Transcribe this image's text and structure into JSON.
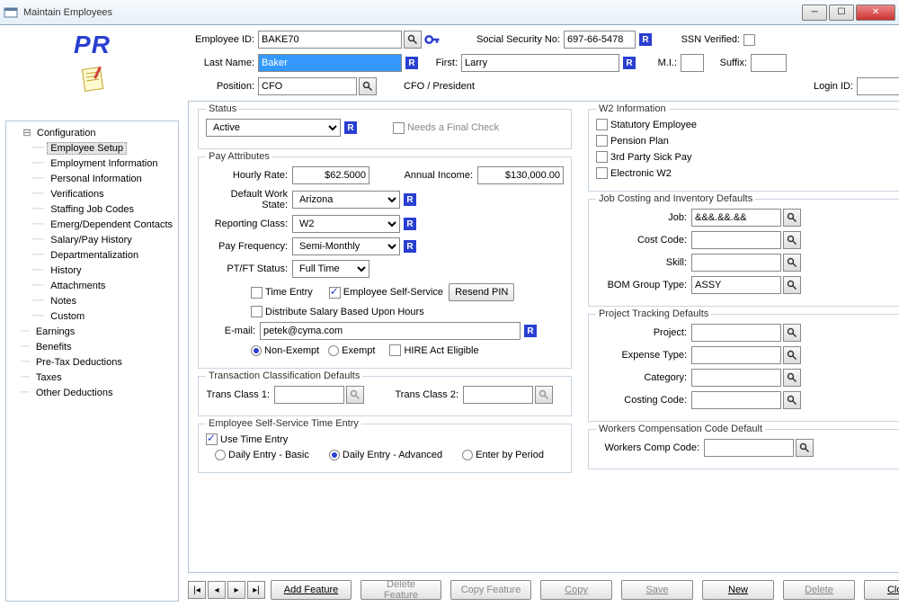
{
  "window": {
    "title": "Maintain Employees"
  },
  "logo": {
    "text": "PR"
  },
  "header": {
    "employee_id_lbl": "Employee ID:",
    "employee_id": "BAKE70",
    "ssn_lbl": "Social Security No:",
    "ssn": "697-66-5478",
    "ssn_verified_lbl": "SSN Verified:",
    "last_name_lbl": "Last Name:",
    "last_name": "Baker",
    "first_lbl": "First:",
    "first": "Larry",
    "mi_lbl": "M.I.:",
    "mi": "",
    "suffix_lbl": "Suffix:",
    "suffix": "",
    "position_lbl": "Position:",
    "position": "CFO",
    "position_desc": "CFO / President",
    "login_id_lbl": "Login ID:",
    "login_id": ""
  },
  "tree": {
    "configuration": "Configuration",
    "items": [
      "Employee Setup",
      "Employment Information",
      "Personal Information",
      "Verifications",
      "Staffing Job Codes",
      "Emerg/Dependent Contacts",
      "Salary/Pay History",
      "Departmentalization",
      "History",
      "Attachments",
      "Notes",
      "Custom"
    ],
    "roots": [
      "Earnings",
      "Benefits",
      "Pre-Tax Deductions",
      "Taxes",
      "Other Deductions"
    ]
  },
  "status": {
    "legend": "Status",
    "value": "Active",
    "needs_final": "Needs a Final Check"
  },
  "pay": {
    "legend": "Pay Attributes",
    "hourly_lbl": "Hourly Rate:",
    "hourly": "$62.5000",
    "annual_lbl": "Annual Income:",
    "annual": "$130,000.00",
    "workstate_lbl": "Default Work State:",
    "workstate": "Arizona",
    "repclass_lbl": "Reporting Class:",
    "repclass": "W2",
    "payfreq_lbl": "Pay Frequency:",
    "payfreq": "Semi-Monthly",
    "ptft_lbl": "PT/FT Status:",
    "ptft": "Full Time",
    "time_entry": "Time Entry",
    "ess": "Employee Self-Service",
    "resend_pin": "Resend PIN",
    "dist_salary": "Distribute Salary Based Upon Hours",
    "email_lbl": "E-mail:",
    "email": "petek@cyma.com",
    "nonexempt": "Non-Exempt",
    "exempt": "Exempt",
    "hire_act": "HIRE Act Eligible"
  },
  "tcd": {
    "legend": "Transaction Classification Defaults",
    "c1_lbl": "Trans Class 1:",
    "c1": "",
    "c2_lbl": "Trans Class 2:",
    "c2": ""
  },
  "ess_time": {
    "legend": "Employee Self-Service Time Entry",
    "use": "Use Time Entry",
    "basic": "Daily Entry - Basic",
    "adv": "Daily Entry - Advanced",
    "period": "Enter by Period"
  },
  "w2info": {
    "legend": "W2 Information",
    "stat": "Statutory Employee",
    "pension": "Pension Plan",
    "sick": "3rd Party Sick Pay",
    "ew2": "Electronic W2"
  },
  "jobcost": {
    "legend": "Job Costing and Inventory Defaults",
    "job_lbl": "Job:",
    "job": "&&&.&&.&&",
    "cost_lbl": "Cost Code:",
    "cost": "",
    "skill_lbl": "Skill:",
    "skill": "",
    "bom_lbl": "BOM Group Type:",
    "bom": "ASSY"
  },
  "proj": {
    "legend": "Project Tracking Defaults",
    "project_lbl": "Project:",
    "project": "",
    "exp_lbl": "Expense Type:",
    "exp": "",
    "cat_lbl": "Category:",
    "cat": "",
    "cc_lbl": "Costing Code:",
    "cc": ""
  },
  "wcomp": {
    "legend": "Workers Compensation Code Default",
    "lbl": "Workers Comp Code:",
    "val": ""
  },
  "footer": {
    "add": "Add Feature",
    "delf": "Delete Feature",
    "copyf": "Copy Feature",
    "copy": "Copy",
    "save": "Save",
    "new": "New",
    "delete": "Delete",
    "close": "Close"
  }
}
